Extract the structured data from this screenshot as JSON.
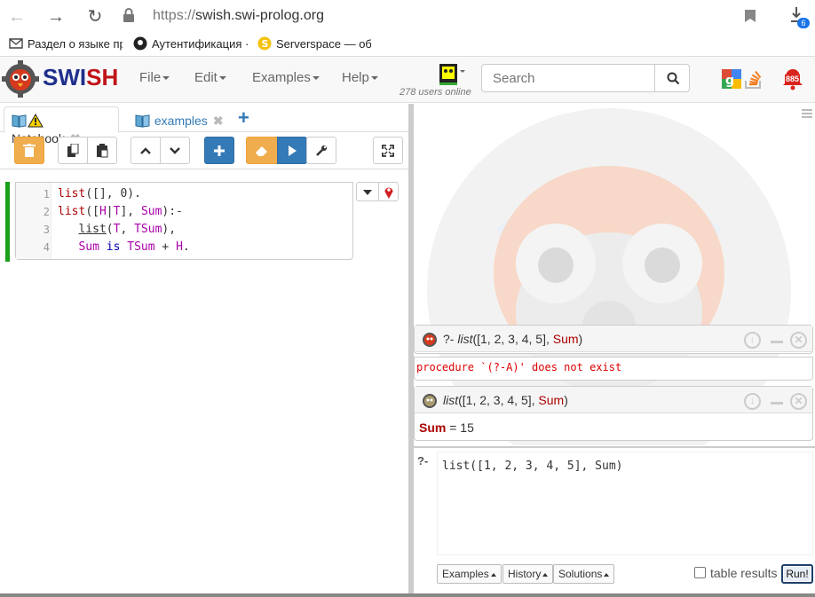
{
  "browser": {
    "url_scheme": "https://",
    "url_host": "swish.swi-prolog.org",
    "bookmarks": [
      "Раздел о языке пр",
      "Аутентификация ·",
      "Serverspace — об"
    ],
    "download_badge": "6"
  },
  "navbar": {
    "brand_s": "S",
    "brand_wi": "WI",
    "brand_sh": "SH",
    "menus": [
      "File",
      "Edit",
      "Examples",
      "Help"
    ],
    "users_online": "278 users online",
    "search_placeholder": "Search",
    "notification_count": "885"
  },
  "tabs": [
    {
      "label": "Notebook",
      "active": true
    },
    {
      "label": "examples",
      "active": false
    }
  ],
  "editor": {
    "lines": [
      {
        "n": "1"
      },
      {
        "n": "2"
      },
      {
        "n": "3"
      },
      {
        "n": "4"
      }
    ]
  },
  "queries": [
    {
      "prompt": "?-",
      "goal_head": "list",
      "goal_args": "([1, 2, 3, 4, 5], ",
      "goal_var": "Sum",
      "goal_close": ")",
      "error": "procedure `(?-A)' does not exist"
    },
    {
      "goal_head": "list",
      "goal_args": "([1, 2, 3, 4, 5], ",
      "goal_var": "Sum",
      "goal_close": ")",
      "answer_var": "Sum",
      "answer_eq": " = 15"
    }
  ],
  "query_input": {
    "prompt": "?-",
    "text": "list([1, 2, 3, 4, 5], Sum)"
  },
  "bottom_buttons": {
    "examples": "Examples",
    "history": "History",
    "solutions": "Solutions",
    "table_results": "table results",
    "run": "Run!"
  },
  "colors": {
    "brand_blue": "#1f2f8c",
    "brand_red": "#c0141a",
    "primary": "#337ab7",
    "warning": "#f0ad4e",
    "run_border": "#2a5a9a"
  }
}
